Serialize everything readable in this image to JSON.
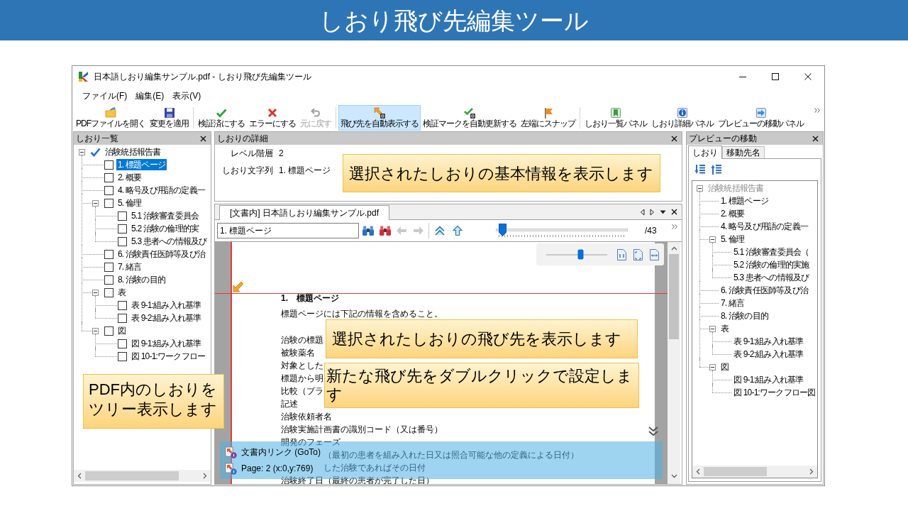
{
  "banner": {
    "title": "しおり飛び先編集ツール"
  },
  "window": {
    "title": "日本語しおり編集サンプル.pdf - しおり飛び先編集ツール"
  },
  "menu": [
    "ファイル(F)",
    "編集(E)",
    "表示(V)"
  ],
  "toolbar": [
    [
      {
        "label": "PDFファイルを開く",
        "pressed": false,
        "disabled": false
      },
      {
        "label": "変更を適用",
        "pressed": false,
        "disabled": false
      }
    ],
    [
      {
        "label": "検証済にする",
        "pressed": false,
        "disabled": false
      },
      {
        "label": "エラーにする",
        "pressed": false,
        "disabled": false
      },
      {
        "label": "元に戻す",
        "pressed": false,
        "disabled": true
      }
    ],
    [
      {
        "label": "飛び先を自動表示する",
        "pressed": true,
        "disabled": false
      },
      {
        "label": "検証マークを自動更新する",
        "pressed": false,
        "disabled": false
      },
      {
        "label": "左端にスナップ",
        "pressed": false,
        "disabled": false
      }
    ],
    [
      {
        "label": "しおり一覧パネル",
        "pressed": false,
        "disabled": false
      },
      {
        "label": "しおり詳細パネル",
        "pressed": false,
        "disabled": false
      },
      {
        "label": "プレビューの移動パネル",
        "pressed": false,
        "disabled": false
      }
    ]
  ],
  "bookmarks_panel": {
    "title": "しおり一覧",
    "tree": [
      {
        "label": "治験統括報告書",
        "checked": true,
        "selected": false,
        "expanded": true,
        "children": [
          {
            "label": "1. 標題ページ",
            "checked": false,
            "selected": true
          },
          {
            "label": "2. 概要",
            "checked": false,
            "selected": false
          },
          {
            "label": "4. 略号及び用語の定義一",
            "checked": false,
            "selected": false
          },
          {
            "label": "5. 倫理",
            "checked": false,
            "selected": false,
            "expanded": true,
            "children": [
              {
                "label": "5.1 治験審査委員会",
                "checked": false,
                "selected": false
              },
              {
                "label": "5.2 治験の倫理的実",
                "checked": false,
                "selected": false
              },
              {
                "label": "5.3 患者への情報及び",
                "checked": false,
                "selected": false
              }
            ]
          },
          {
            "label": "6. 治験責任医師等及び治",
            "checked": false,
            "selected": false
          },
          {
            "label": "7. 緒言",
            "checked": false,
            "selected": false
          },
          {
            "label": "8. 治験の目的",
            "checked": false,
            "selected": false
          },
          {
            "label": "表",
            "checked": false,
            "selected": false,
            "expanded": true,
            "children": [
              {
                "label": "表 9-1:組み入れ基準",
                "checked": false,
                "selected": false
              },
              {
                "label": "表 9-2:組み入れ基準",
                "checked": false,
                "selected": false
              }
            ]
          },
          {
            "label": "図",
            "checked": false,
            "selected": false,
            "expanded": true,
            "children": [
              {
                "label": "図 9-1:組み入れ基準",
                "checked": false,
                "selected": false
              },
              {
                "label": "図 10-1:ワークフロー",
                "checked": false,
                "selected": false
              }
            ]
          }
        ]
      }
    ],
    "callout": "PDF内のしおりをツリー表示します"
  },
  "detail_panel": {
    "title": "しおりの詳細",
    "fields": [
      {
        "label": "レベル階層",
        "value": "2"
      },
      {
        "label": "しおり文字列",
        "value": "1. 標題ページ"
      }
    ],
    "callout": "選択されたしおりの基本情報を表示します"
  },
  "document": {
    "tab": {
      "label": "[文書内] 日本語しおり編集サンプル.pdf",
      "selected": true
    },
    "bookmark_field": {
      "value": "1. 標題ページ"
    },
    "page_slider": {
      "level": 0.02
    },
    "page_count": "/43",
    "zoom_slider": {
      "level": 0.57
    },
    "page": {
      "lines": [
        {
          "kind": "heading",
          "text": "1.　標題ページ"
        },
        {
          "kind": "lead",
          "text": "標題ページには下記の情報を含めること。"
        },
        {
          "kind": "item",
          "text": "治験の標題"
        },
        {
          "kind": "item",
          "text": "被験薬名"
        },
        {
          "kind": "item",
          "text": "対象とした"
        },
        {
          "kind": "item",
          "text": "標題から明"
        },
        {
          "kind": "item",
          "text": "比較（プラ"
        },
        {
          "kind": "item",
          "text": "記述"
        },
        {
          "kind": "item",
          "text": "治験依頼者名"
        },
        {
          "kind": "item",
          "text": "治験実施計画書の識別コード（又は番号）"
        },
        {
          "kind": "item",
          "text": "開発のフェーズ"
        },
        {
          "kind": "covered_start",
          "text": "（最初の患者を組み入れた日又は照合可能な他の定義による日付）"
        },
        {
          "kind": "covered_start",
          "text": "した治験であればその日付"
        },
        {
          "kind": "item",
          "text": "治験終了日（最終の患者が完了した日）"
        }
      ]
    },
    "link_info": [
      {
        "kind": "goto",
        "text": "文書内リンク (GoTo)"
      },
      {
        "kind": "page",
        "text": "Page: 2 (x:0,y:769)"
      }
    ],
    "callouts": [
      "選択されたしおりの飛び先を表示します",
      "新たな飛び先をダブルクリックで設定します"
    ]
  },
  "preview_panel": {
    "title": "プレビューの移動",
    "tabs": [
      {
        "label": "しおり",
        "selected": true
      },
      {
        "label": "移動先名",
        "selected": false
      }
    ],
    "tree": [
      {
        "label": "治験統括報告書",
        "disabled": true,
        "expanded": true,
        "children": [
          {
            "label": "1. 標題ページ",
            "disabled": false
          },
          {
            "label": "2. 概要",
            "disabled": false
          },
          {
            "label": "4. 略号及び用語の定義一",
            "disabled": false
          },
          {
            "label": "5. 倫理",
            "disabled": false,
            "expanded": true,
            "children": [
              {
                "label": "5.1 治験審査委員会（",
                "disabled": false
              },
              {
                "label": "5.2 治験の倫理的実施",
                "disabled": false
              },
              {
                "label": "5.3 患者への情報及び",
                "disabled": false
              }
            ]
          },
          {
            "label": "6. 治験責任医師等及び治",
            "disabled": false
          },
          {
            "label": "7. 緒言",
            "disabled": false
          },
          {
            "label": "8. 治験の目的",
            "disabled": false
          },
          {
            "label": "表",
            "disabled": false,
            "expanded": true,
            "children": [
              {
                "label": "表 9-1:組み入れ基準",
                "disabled": false
              },
              {
                "label": "表 9-2:組み入れ基準",
                "disabled": false
              }
            ]
          },
          {
            "label": "図",
            "disabled": false,
            "expanded": true,
            "children": [
              {
                "label": "図 9-1:組み入れ基準",
                "disabled": false
              },
              {
                "label": "図 10-1:ワークフロー図",
                "disabled": false
              }
            ]
          }
        ]
      }
    ]
  }
}
